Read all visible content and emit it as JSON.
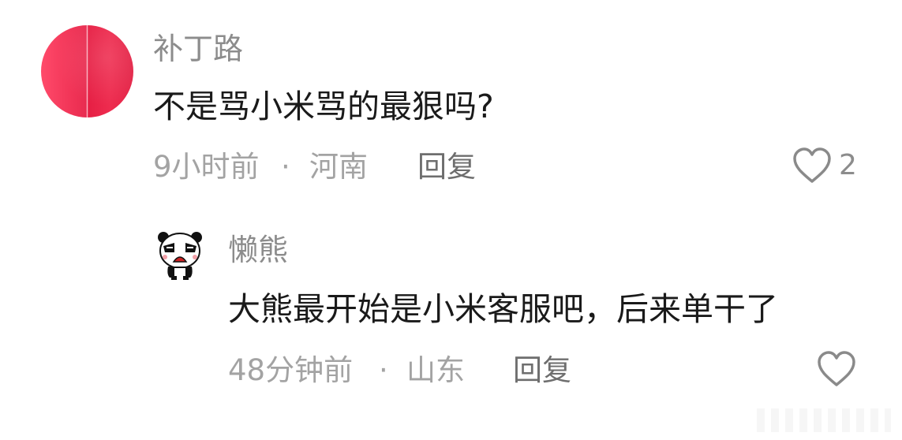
{
  "comment": {
    "username": "补丁路",
    "text": "不是骂小米骂的最狠吗?",
    "time": "9小时前",
    "separator": "·",
    "location": "河南",
    "reply_label": "回复",
    "like_count": "2"
  },
  "reply": {
    "username": "懒熊",
    "text": "大熊最开始是小米客服吧，后来单干了",
    "time": "48分钟前",
    "separator": "·",
    "location": "山东",
    "reply_label": "回复"
  },
  "icons": {
    "like": "heart-outline-icon",
    "avatar_reply": "panda-avatar"
  },
  "colors": {
    "avatar_main": "#ec2b4f",
    "heart": "#8a8a8a",
    "meta_text": "#a3a3a3"
  }
}
